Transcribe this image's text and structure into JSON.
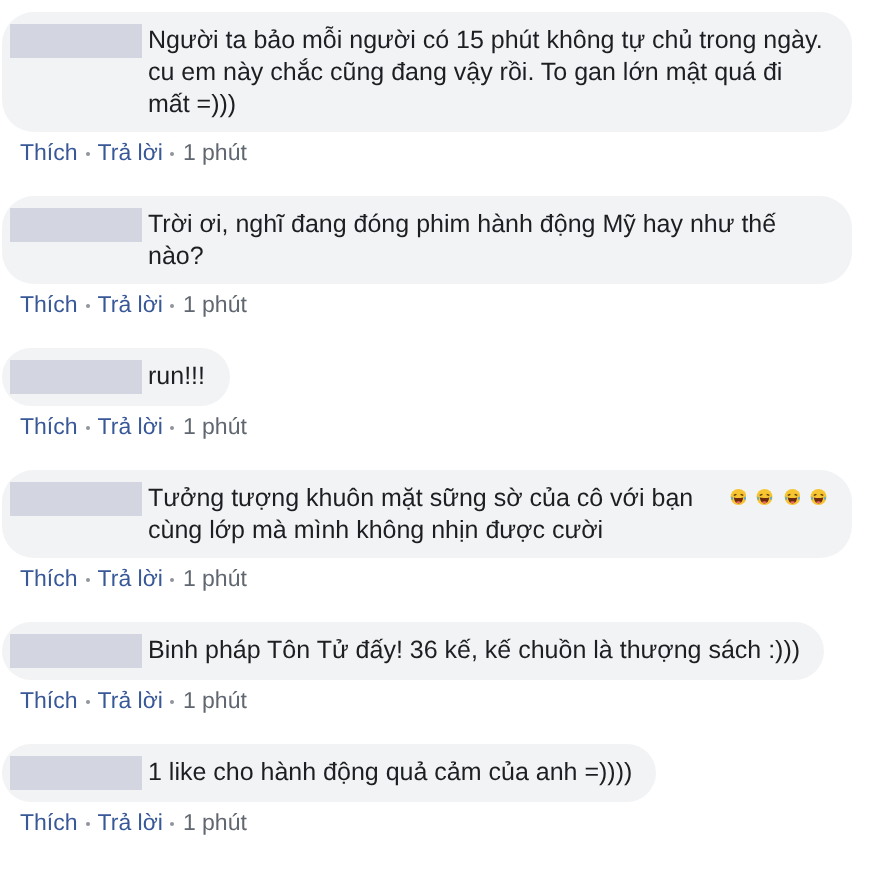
{
  "comments": [
    {
      "text": "Người ta bảo mỗi người có 15 phút không tự chủ trong ngày. cu em này chắc cũng đang vậy rồi. To gan lớn mật quá đi mất =)))",
      "actions": [
        "Thích",
        "Trả lời",
        "1 phút"
      ]
    },
    {
      "text": "Trời ơi, nghĩ đang đóng phim hành động Mỹ hay như thế nào?",
      "actions": [
        "Thích",
        "Trả lời",
        "1 phút"
      ]
    },
    {
      "text": "run!!!",
      "actions": [
        "Thích",
        "Trả lời",
        "1 phút"
      ]
    },
    {
      "text": "Tưởng tượng khuôn mặt sững sờ của cô với bạn cùng lớp mà mình không nhịn được cười",
      "emoji": [
        {
          "kind": "laughing"
        },
        {
          "kind": "laughing"
        },
        {
          "kind": "laughing"
        },
        {
          "kind": "laughing"
        }
      ],
      "actions": [
        "Thích",
        "Trả lời",
        "1 phút"
      ]
    },
    {
      "text": "Binh pháp Tôn Tử đấy! 36 kế, kế chuồn là thượng sách :)))",
      "actions": [
        "Thích",
        "Trả lời",
        "1 phút"
      ]
    },
    {
      "text": "1 like cho hành động quả cảm của anh =))))",
      "actions": [
        "Thích",
        "Trả lời",
        "1 phút"
      ]
    }
  ]
}
